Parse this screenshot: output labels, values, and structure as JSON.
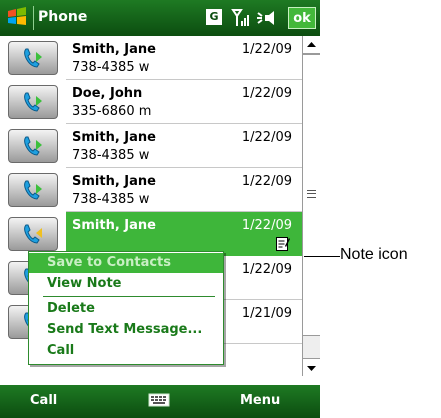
{
  "titlebar": {
    "app_title": "Phone",
    "signal_label": "G",
    "ok_label": "ok"
  },
  "calls": [
    {
      "name": "Smith, Jane",
      "number": "738-4385 w",
      "date": "1/22/09",
      "type": "outgoing"
    },
    {
      "name": "Doe, John",
      "number": "335-6860 m",
      "date": "1/22/09",
      "type": "outgoing"
    },
    {
      "name": "Smith, Jane",
      "number": "738-4385 w",
      "date": "1/22/09",
      "type": "outgoing"
    },
    {
      "name": "Smith, Jane",
      "number": "738-4385 w",
      "date": "1/22/09",
      "type": "outgoing"
    },
    {
      "name": "Smith, Jane",
      "number": "",
      "date": "1/22/09",
      "type": "incoming",
      "selected": true
    },
    {
      "name": "",
      "number": "",
      "date": "1/22/09",
      "type": "outgoing"
    },
    {
      "name": "",
      "number": "",
      "date": "1/21/09",
      "type": "outgoing"
    }
  ],
  "context_menu": {
    "items": [
      {
        "label": "Save to Contacts",
        "active": true
      },
      {
        "label": "View Note"
      },
      {
        "label": "Delete"
      },
      {
        "label": "Send Text Message..."
      },
      {
        "label": "Call"
      }
    ]
  },
  "menubar": {
    "left_softkey": "Call",
    "right_softkey": "Menu"
  },
  "callout": {
    "label": "Note icon"
  },
  "colors": {
    "title_green": "#1e7a23",
    "highlight_green": "#3eb63a",
    "menu_text_green": "#1a7a1a"
  },
  "icons": [
    "windows-start-icon",
    "antenna-icon",
    "speaker-icon",
    "phone-outgoing-icon",
    "phone-incoming-icon",
    "note-icon",
    "keyboard-icon"
  ]
}
